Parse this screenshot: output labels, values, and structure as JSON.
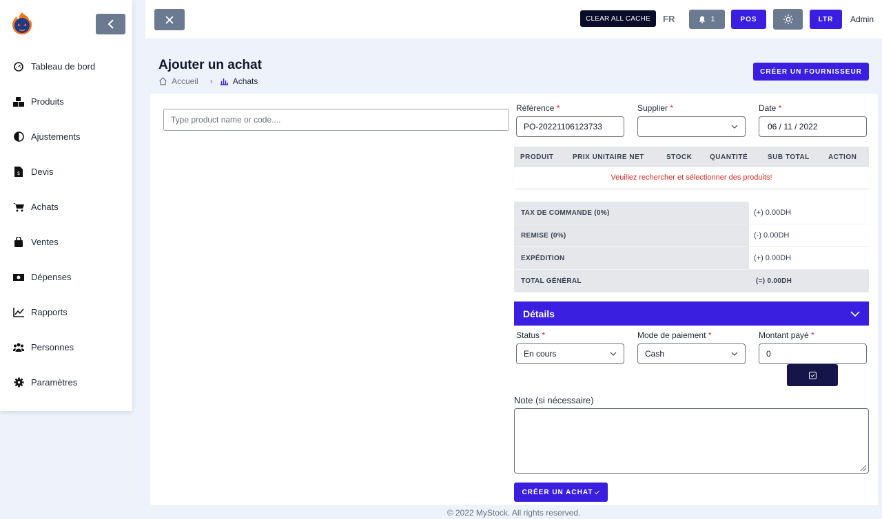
{
  "sidebar": {
    "items": [
      {
        "label": "Tableau de bord",
        "icon": "dashboard-icon"
      },
      {
        "label": "Produits",
        "icon": "products-icon"
      },
      {
        "label": "Ajustements",
        "icon": "adjustments-icon"
      },
      {
        "label": "Devis",
        "icon": "quotation-icon"
      },
      {
        "label": "Achats",
        "icon": "cart-icon"
      },
      {
        "label": "Ventes",
        "icon": "bag-icon"
      },
      {
        "label": "Dépenses",
        "icon": "money-icon"
      },
      {
        "label": "Rapports",
        "icon": "chart-line-icon"
      },
      {
        "label": "Personnes",
        "icon": "people-icon"
      },
      {
        "label": "Paramètres",
        "icon": "gear-icon"
      }
    ]
  },
  "topbar": {
    "clear_cache": "CLEAR ALL CACHE",
    "lang": "FR",
    "notifications_count": "1",
    "pos": "POS",
    "ltr": "LTR",
    "user": "Admin"
  },
  "page": {
    "title": "Ajouter un achat",
    "breadcrumb": {
      "home": "Accueil",
      "current": "Achats"
    },
    "create_supplier": "CRÉER UN FOURNISSEUR"
  },
  "form": {
    "search_placeholder": "Type product name or code....",
    "reference": {
      "label": "Référence",
      "value": "PO-20221106123733"
    },
    "supplier": {
      "label": "Supplier",
      "value": ""
    },
    "date": {
      "label": "Date",
      "value": "06 / 11 / 2022"
    },
    "required_mark": "*"
  },
  "product_table": {
    "columns": [
      "PRODUIT",
      "PRIX UNITAIRE NET",
      "STOCK",
      "QUANTITÉ",
      "SUB TOTAL",
      "ACTION"
    ],
    "empty_message": "Veuillez rechercher et sélectionner des produits!"
  },
  "totals": [
    {
      "label": "TAX DE COMMANDE (0%)",
      "value": "(+) 0.00DH"
    },
    {
      "label": "REMISE (0%)",
      "value": "(-) 0.00DH"
    },
    {
      "label": "EXPÉDITION",
      "value": "(+) 0.00DH"
    },
    {
      "label": "TOTAL GÉNÉRAL",
      "value": "(=) 0.00DH"
    }
  ],
  "details": {
    "title": "Détails",
    "status": {
      "label": "Status",
      "value": "En cours"
    },
    "payment_method": {
      "label": "Mode de paiement",
      "value": "Cash"
    },
    "amount_paid": {
      "label": "Montant payé",
      "value": "0"
    }
  },
  "note": {
    "label": "Note (si nécessaire)",
    "value": ""
  },
  "create_purchase": "CRÉER UN ACHAT",
  "footer": "© 2022 MyStock. All rights reserved.",
  "colors": {
    "primary": "#3b1fe0",
    "gray_button": "#6b7a90",
    "dark": "#0b0b2a",
    "danger": "#dc2626",
    "background": "#eef2fa"
  }
}
